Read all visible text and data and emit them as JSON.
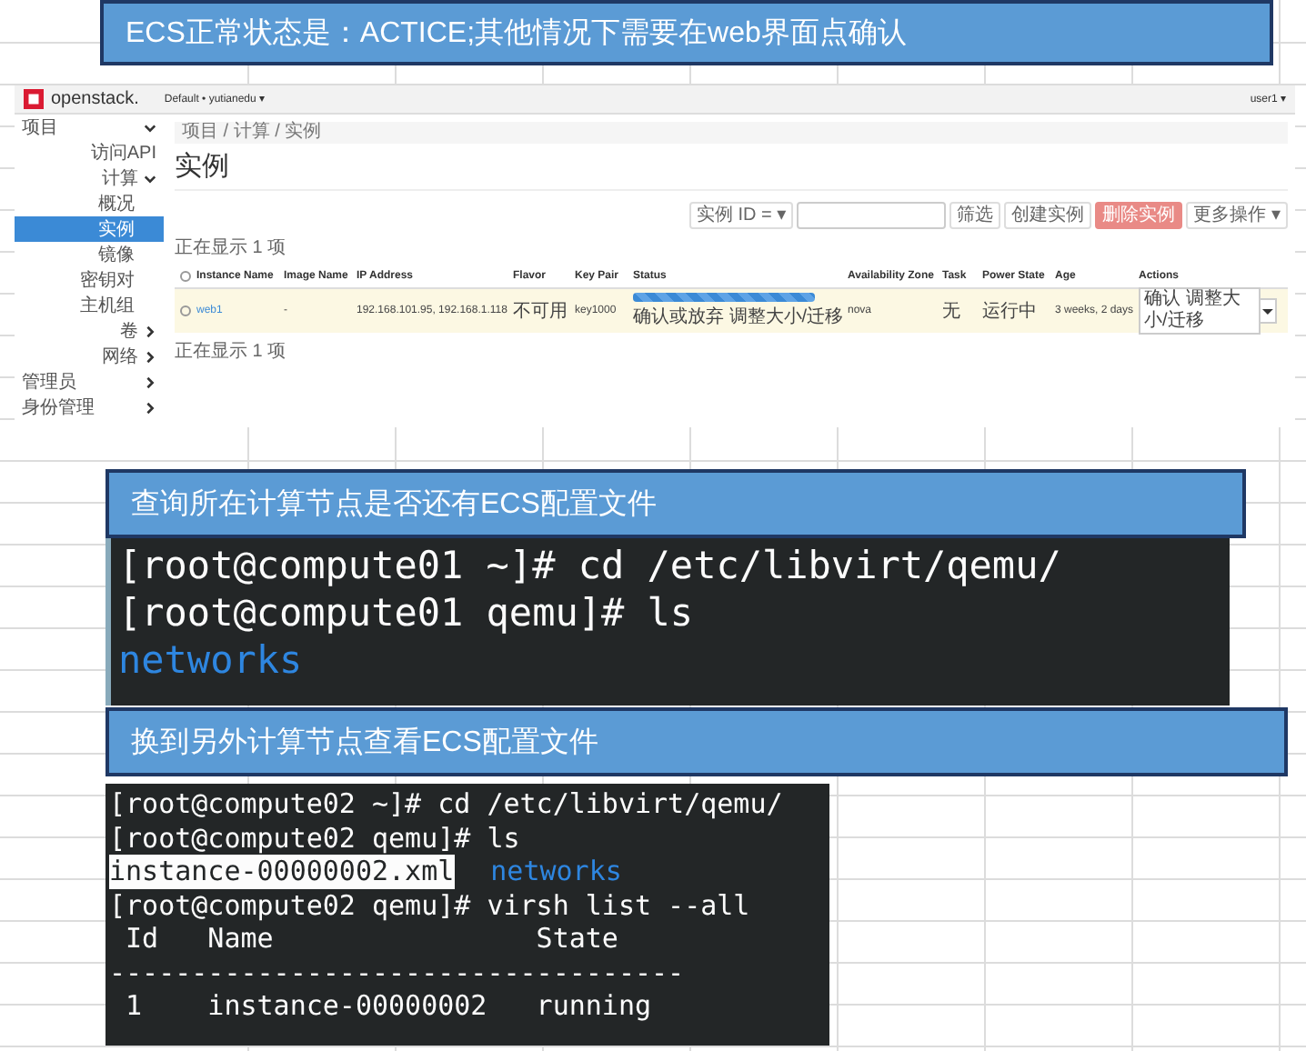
{
  "banner_top": {
    "text": "ECS正常状态是：ACTICE;其他情况下需要在web界面点确认"
  },
  "openstack": {
    "logo": "openstack.",
    "project_menu": "Default • yutianedu ▾",
    "user_menu": "user1 ▾",
    "sidebar": [
      {
        "label": "项目",
        "expanded": true,
        "selected": false,
        "children": [
          {
            "label": "访问API",
            "selected": false
          },
          {
            "label": "计算",
            "expanded": true,
            "selected": false,
            "children": [
              {
                "label": "概况",
                "selected": false
              },
              {
                "label": "实例",
                "selected": true
              },
              {
                "label": "镜像",
                "selected": false
              },
              {
                "label": "密钥对",
                "selected": false
              },
              {
                "label": "主机组",
                "selected": false
              }
            ]
          },
          {
            "label": "卷",
            "expanded": false,
            "selected": false
          },
          {
            "label": "网络",
            "expanded": false,
            "selected": false
          }
        ]
      },
      {
        "label": "管理员",
        "expanded": false,
        "selected": false
      },
      {
        "label": "身份管理",
        "expanded": false,
        "selected": false
      }
    ],
    "breadcrumb": "项目 / 计算 / 实例",
    "title": "实例",
    "filter_select": "实例 ID = ▾",
    "filter_button": "筛选",
    "create_button": "创建实例",
    "delete_button": "删除实例",
    "more_button": "更多操作 ▾",
    "count_top": "正在显示 1 项",
    "count_bottom": "正在显示 1 项",
    "select_all_checked": false,
    "columns": [
      "Instance Name",
      "Image Name",
      "IP Address",
      "Flavor",
      "Key Pair",
      "Status",
      "Availability Zone",
      "Task",
      "Power State",
      "Age",
      "Actions"
    ],
    "rows": [
      {
        "checked": false,
        "name": "web1",
        "image": "-",
        "ip": "192.168.101.95, 192.168.1.118",
        "flavor": "不可用",
        "key_pair": "key1000",
        "status": {
          "level": 1,
          "text": "确认或放弃 调整大小/迁移"
        },
        "zone": "nova",
        "task": "无",
        "power_state": "运行中",
        "age": "3 weeks, 2 days",
        "action": "确认 调整大小/迁移"
      }
    ]
  },
  "banner_middle": {
    "text": "查询所在计算节点是否还有ECS配置文件"
  },
  "terminal_1": {
    "lines": [
      [
        {
          "text": "[root@compute01 ~]# cd /etc/libvirt/qemu/",
          "kind": "plain"
        }
      ],
      [
        {
          "text": "[root@compute01 qemu]# ls",
          "kind": "plain"
        }
      ],
      [
        {
          "text": "networks",
          "kind": "dir"
        }
      ]
    ]
  },
  "banner_bottom": {
    "text": "换到另外计算节点查看ECS配置文件"
  },
  "terminal_2": {
    "lines": [
      [
        {
          "text": "[root@compute02 ~]# cd /etc/libvirt/qemu/",
          "kind": "plain"
        }
      ],
      [
        {
          "text": "[root@compute02 qemu]# ls",
          "kind": "plain"
        }
      ],
      [
        {
          "text": "instance-00000002.xml",
          "kind": "highlight"
        },
        {
          "text": "networks",
          "kind": "dir"
        }
      ],
      [
        {
          "text": "[root@compute02 qemu]# virsh list --all",
          "kind": "plain"
        }
      ],
      [
        {
          "text": " Id   Name                State",
          "kind": "plain"
        }
      ],
      [
        {
          "text": "-----------------------------------",
          "kind": "plain"
        }
      ],
      [
        {
          "text": " 1    instance-00000002   running",
          "kind": "plain"
        }
      ]
    ]
  }
}
